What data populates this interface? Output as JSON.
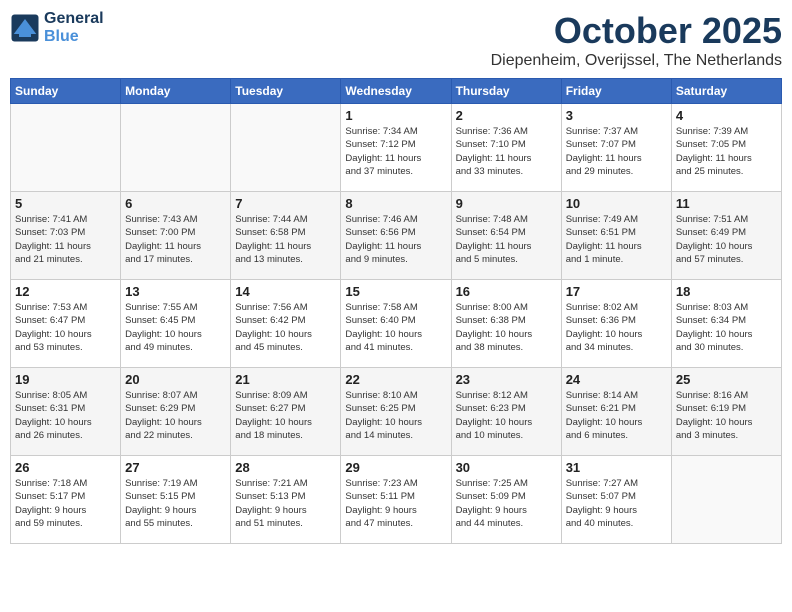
{
  "logo": {
    "line1": "General",
    "line2": "Blue"
  },
  "title": "October 2025",
  "subtitle": "Diepenheim, Overijssel, The Netherlands",
  "days_of_week": [
    "Sunday",
    "Monday",
    "Tuesday",
    "Wednesday",
    "Thursday",
    "Friday",
    "Saturday"
  ],
  "weeks": [
    [
      {
        "day": "",
        "info": ""
      },
      {
        "day": "",
        "info": ""
      },
      {
        "day": "",
        "info": ""
      },
      {
        "day": "1",
        "info": "Sunrise: 7:34 AM\nSunset: 7:12 PM\nDaylight: 11 hours\nand 37 minutes."
      },
      {
        "day": "2",
        "info": "Sunrise: 7:36 AM\nSunset: 7:10 PM\nDaylight: 11 hours\nand 33 minutes."
      },
      {
        "day": "3",
        "info": "Sunrise: 7:37 AM\nSunset: 7:07 PM\nDaylight: 11 hours\nand 29 minutes."
      },
      {
        "day": "4",
        "info": "Sunrise: 7:39 AM\nSunset: 7:05 PM\nDaylight: 11 hours\nand 25 minutes."
      }
    ],
    [
      {
        "day": "5",
        "info": "Sunrise: 7:41 AM\nSunset: 7:03 PM\nDaylight: 11 hours\nand 21 minutes."
      },
      {
        "day": "6",
        "info": "Sunrise: 7:43 AM\nSunset: 7:00 PM\nDaylight: 11 hours\nand 17 minutes."
      },
      {
        "day": "7",
        "info": "Sunrise: 7:44 AM\nSunset: 6:58 PM\nDaylight: 11 hours\nand 13 minutes."
      },
      {
        "day": "8",
        "info": "Sunrise: 7:46 AM\nSunset: 6:56 PM\nDaylight: 11 hours\nand 9 minutes."
      },
      {
        "day": "9",
        "info": "Sunrise: 7:48 AM\nSunset: 6:54 PM\nDaylight: 11 hours\nand 5 minutes."
      },
      {
        "day": "10",
        "info": "Sunrise: 7:49 AM\nSunset: 6:51 PM\nDaylight: 11 hours\nand 1 minute."
      },
      {
        "day": "11",
        "info": "Sunrise: 7:51 AM\nSunset: 6:49 PM\nDaylight: 10 hours\nand 57 minutes."
      }
    ],
    [
      {
        "day": "12",
        "info": "Sunrise: 7:53 AM\nSunset: 6:47 PM\nDaylight: 10 hours\nand 53 minutes."
      },
      {
        "day": "13",
        "info": "Sunrise: 7:55 AM\nSunset: 6:45 PM\nDaylight: 10 hours\nand 49 minutes."
      },
      {
        "day": "14",
        "info": "Sunrise: 7:56 AM\nSunset: 6:42 PM\nDaylight: 10 hours\nand 45 minutes."
      },
      {
        "day": "15",
        "info": "Sunrise: 7:58 AM\nSunset: 6:40 PM\nDaylight: 10 hours\nand 41 minutes."
      },
      {
        "day": "16",
        "info": "Sunrise: 8:00 AM\nSunset: 6:38 PM\nDaylight: 10 hours\nand 38 minutes."
      },
      {
        "day": "17",
        "info": "Sunrise: 8:02 AM\nSunset: 6:36 PM\nDaylight: 10 hours\nand 34 minutes."
      },
      {
        "day": "18",
        "info": "Sunrise: 8:03 AM\nSunset: 6:34 PM\nDaylight: 10 hours\nand 30 minutes."
      }
    ],
    [
      {
        "day": "19",
        "info": "Sunrise: 8:05 AM\nSunset: 6:31 PM\nDaylight: 10 hours\nand 26 minutes."
      },
      {
        "day": "20",
        "info": "Sunrise: 8:07 AM\nSunset: 6:29 PM\nDaylight: 10 hours\nand 22 minutes."
      },
      {
        "day": "21",
        "info": "Sunrise: 8:09 AM\nSunset: 6:27 PM\nDaylight: 10 hours\nand 18 minutes."
      },
      {
        "day": "22",
        "info": "Sunrise: 8:10 AM\nSunset: 6:25 PM\nDaylight: 10 hours\nand 14 minutes."
      },
      {
        "day": "23",
        "info": "Sunrise: 8:12 AM\nSunset: 6:23 PM\nDaylight: 10 hours\nand 10 minutes."
      },
      {
        "day": "24",
        "info": "Sunrise: 8:14 AM\nSunset: 6:21 PM\nDaylight: 10 hours\nand 6 minutes."
      },
      {
        "day": "25",
        "info": "Sunrise: 8:16 AM\nSunset: 6:19 PM\nDaylight: 10 hours\nand 3 minutes."
      }
    ],
    [
      {
        "day": "26",
        "info": "Sunrise: 7:18 AM\nSunset: 5:17 PM\nDaylight: 9 hours\nand 59 minutes."
      },
      {
        "day": "27",
        "info": "Sunrise: 7:19 AM\nSunset: 5:15 PM\nDaylight: 9 hours\nand 55 minutes."
      },
      {
        "day": "28",
        "info": "Sunrise: 7:21 AM\nSunset: 5:13 PM\nDaylight: 9 hours\nand 51 minutes."
      },
      {
        "day": "29",
        "info": "Sunrise: 7:23 AM\nSunset: 5:11 PM\nDaylight: 9 hours\nand 47 minutes."
      },
      {
        "day": "30",
        "info": "Sunrise: 7:25 AM\nSunset: 5:09 PM\nDaylight: 9 hours\nand 44 minutes."
      },
      {
        "day": "31",
        "info": "Sunrise: 7:27 AM\nSunset: 5:07 PM\nDaylight: 9 hours\nand 40 minutes."
      },
      {
        "day": "",
        "info": ""
      }
    ]
  ]
}
